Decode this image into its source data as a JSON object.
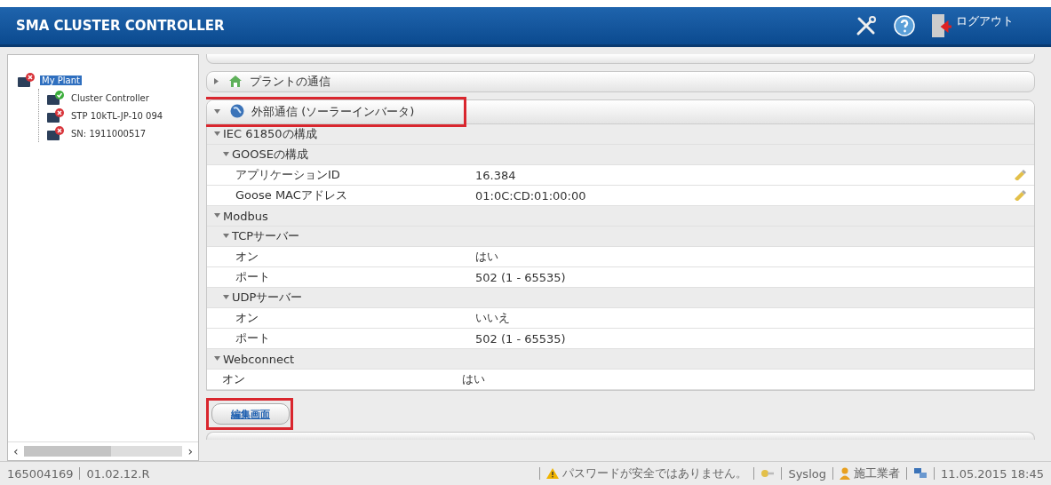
{
  "header": {
    "title": "SMA CLUSTER CONTROLLER",
    "logout": "ログアウト"
  },
  "plant_tree": {
    "items": [
      {
        "label": "My Plant",
        "selected": true,
        "alarm": true,
        "children": [
          {
            "label": "Cluster Controller",
            "selected": false,
            "alarm": false
          },
          {
            "label": "STP 10kTL-JP-10 094",
            "selected": false,
            "alarm": true
          },
          {
            "label": "SN: 1911000517",
            "selected": false,
            "alarm": true
          }
        ]
      }
    ],
    "scroll_left": "‹",
    "scroll_right": "›"
  },
  "sections": [
    {
      "kind": "cut",
      "expanded": false,
      "highlighted": false
    },
    {
      "kind": "house",
      "title": "プラントの通信",
      "expanded": false,
      "highlighted": false
    },
    {
      "kind": "globe",
      "title": "外部通信 (ソーラーインバータ)",
      "expanded": true,
      "highlighted": true,
      "groups": [
        {
          "label": "IEC 61850の構成",
          "children": [
            {
              "label": "GOOSEの構成",
              "children": [
                {
                  "label": "アプリケーションID",
                  "value": "16.384",
                  "editable": true
                },
                {
                  "label": "Goose MACアドレス",
                  "value": "01:0C:CD:01:00:00",
                  "editable": true
                }
              ]
            }
          ]
        },
        {
          "label": "Modbus",
          "children": [
            {
              "label": "TCPサーバー",
              "children": [
                {
                  "label": "オン",
                  "value": "はい",
                  "editable": false
                },
                {
                  "label": "ポート",
                  "value": "502  (1 - 65535)",
                  "editable": false
                }
              ]
            },
            {
              "label": "UDPサーバー",
              "children": [
                {
                  "label": "オン",
                  "value": "いいえ",
                  "editable": false
                },
                {
                  "label": "ポート",
                  "value": "502  (1 - 65535)",
                  "editable": false
                }
              ]
            }
          ]
        },
        {
          "label": "Webconnect",
          "items": [
            {
              "label": "オン",
              "value": "はい",
              "editable": false
            }
          ]
        }
      ],
      "button": {
        "label": "編集画面",
        "highlighted": true
      }
    },
    {
      "kind": "cut",
      "expanded": false,
      "highlighted": false
    }
  ],
  "status_bar": {
    "serial": "165004169",
    "version": "01.02.12.R",
    "warning": "パスワードが安全ではありません。",
    "syslog": "Syslog",
    "installer": "施工業者",
    "datetime": "11.05.2015 18:45"
  }
}
